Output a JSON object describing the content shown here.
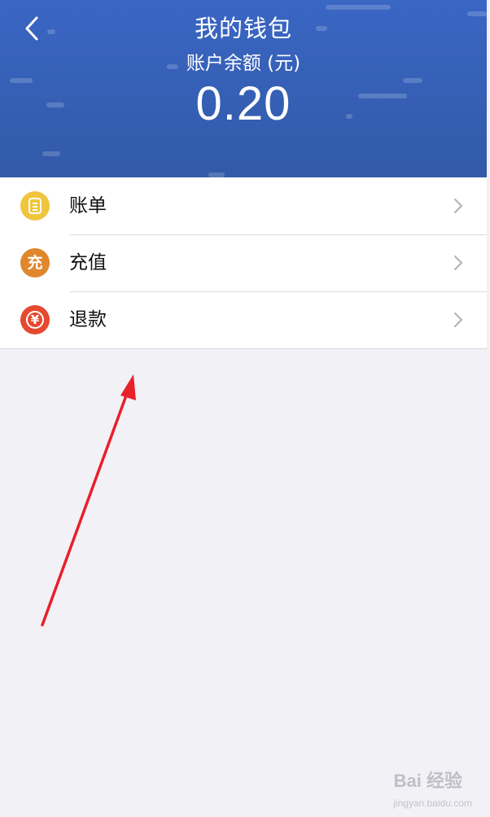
{
  "header": {
    "title": "我的钱包",
    "subtitle": "账户余额 (元)",
    "balance": "0.20",
    "background_color": "#3a66c4"
  },
  "menu": {
    "items": [
      {
        "label": "账单",
        "icon": "bill-icon",
        "icon_color": "#f0c53d"
      },
      {
        "label": "充值",
        "icon": "recharge-icon",
        "icon_glyph": "充",
        "icon_color": "#e0862c"
      },
      {
        "label": "退款",
        "icon": "refund-icon",
        "icon_glyph": "¥",
        "icon_color": "#e5492f"
      }
    ]
  },
  "annotation": {
    "arrow_color": "#e8202a"
  },
  "watermark": {
    "text": "Bai 经验",
    "subtext": "jingyan.baidu.com"
  }
}
